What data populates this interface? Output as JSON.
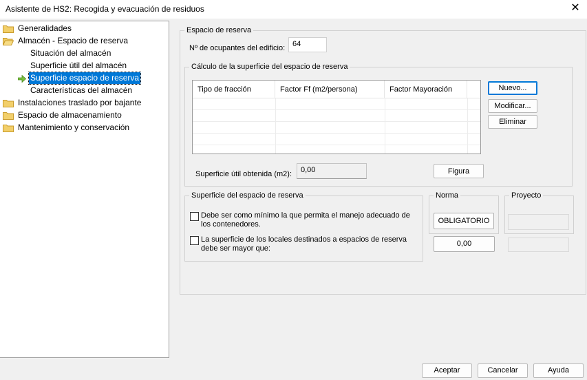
{
  "window": {
    "title": "Asistente de HS2: Recogida y evacuación de residuos",
    "close_glyph": "✕"
  },
  "tree": {
    "items": [
      {
        "label": "Generalidades",
        "type": "folder",
        "icon": "folder-icon"
      },
      {
        "label": "Almacén - Espacio de reserva",
        "type": "folder-open",
        "icon": "folder-open-icon"
      },
      {
        "label": "Situación del almacén",
        "type": "child"
      },
      {
        "label": "Superficie útil del almacén",
        "type": "child"
      },
      {
        "label": "Superficie espacio de reserva",
        "type": "child-selected",
        "icon": "arrow-right-icon"
      },
      {
        "label": "Características del almacén",
        "type": "child"
      },
      {
        "label": "Instalaciones traslado por bajante",
        "type": "folder",
        "icon": "folder-icon"
      },
      {
        "label": "Espacio de almacenamiento",
        "type": "folder",
        "icon": "folder-icon"
      },
      {
        "label": "Mantenimiento y conservación",
        "type": "folder",
        "icon": "folder-icon"
      }
    ]
  },
  "main": {
    "group_title": "Espacio de reserva",
    "occupants_label": "Nº de ocupantes del edificio:",
    "occupants_value": "64",
    "calc": {
      "title": "Cálculo de la superficie del espacio de reserva",
      "columns": [
        "Tipo de fracción",
        "Factor Ff (m2/persona)",
        "Factor Mayoración"
      ],
      "rows": [],
      "buttons": {
        "new": "Nuevo...",
        "modify": "Modificar...",
        "delete": "Eliminar"
      },
      "surface_label": "Superficie útil obtenida (m2):",
      "surface_value": "0,00",
      "figure_button": "Figura"
    },
    "surface": {
      "title": "Superficie del espacio de reserva",
      "check1": "Debe ser como mínimo la que permita el manejo adecuado de los contenedores.",
      "check1_checked": false,
      "check2": "La superficie de los locales destinados a espacios de reserva debe ser mayor que:",
      "check2_checked": false
    },
    "norma": {
      "title": "Norma",
      "value_button": "OBLIGATORIO",
      "number_button": "0,00"
    },
    "proyecto": {
      "title": "Proyecto",
      "value": "",
      "number": ""
    }
  },
  "footer": {
    "accept": "Aceptar",
    "cancel": "Cancelar",
    "help": "Ayuda"
  },
  "colors": {
    "selection": "#0078d7",
    "folder": "#e8c35a",
    "arrow": "#5a9e2f"
  }
}
